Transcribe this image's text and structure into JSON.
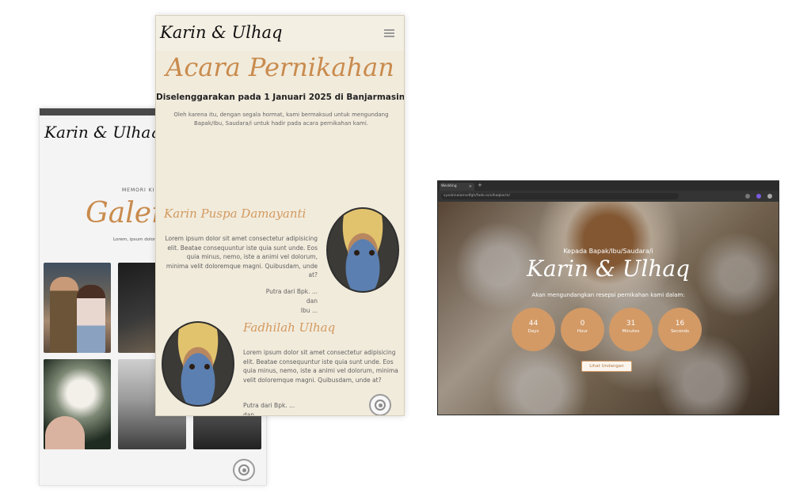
{
  "gallery_screen": {
    "brand": "Karin & Ulhaq",
    "kicker": "MEMORI KI",
    "title": "Galeri",
    "description": "Lorem, ipsum dolor sit amet consec impe"
  },
  "event_screen": {
    "brand": "Karin & Ulhaq",
    "title": "Acara Pernikahan",
    "headline": "Diselenggarakan pada 1 Januari 2025 di Banjarmasin.",
    "intro": "Oleh karena itu, dengan segala hormat, kami bermaksud untuk mengundang Bapak/Ibu, Saudara/i untuk hadir pada acara pernikahan kami.",
    "bride": {
      "name": "Karin Puspa Damayanti",
      "bio": "Lorem ipsum dolor sit amet consectetur adipisicing elit. Beatae consequuntur iste quia sunt unde. Eos quia minus, nemo, iste a animi vel dolorum, minima velit doloremque magni. Quibusdam, unde at?",
      "parents": [
        "Putra dari Bpk. ...",
        "dan",
        "Ibu ..."
      ]
    },
    "groom": {
      "name": "Fadhilah Ulhaq",
      "bio": "Lorem ipsum dolor sit amet consectetur adipisicing elit. Beatae consequuntur iste quia sunt unde. Eos quia minus, nemo, iste a animi vel dolorum, minima velit doloremque magni. Quibusdam, unde at?",
      "parents": [
        "Putra dari Bpk. ...",
        "dan"
      ]
    }
  },
  "browser": {
    "tab_title": "Wedding",
    "url": "syarbinalamsdfgh/fade.io/ulhaqkarin/",
    "hero": {
      "salutation": "Kepada Bapak/Ibu/Saudara/i",
      "couple": "Karin & Ulhaq",
      "invitation": "Akan mengundangkan resepsi pernikahan kami dalam:",
      "countdown": [
        {
          "value": "44",
          "unit": "Days"
        },
        {
          "value": "0",
          "unit": "Hour"
        },
        {
          "value": "31",
          "unit": "Minutes"
        },
        {
          "value": "16",
          "unit": "Seconds"
        }
      ],
      "cta_label": "Lihat Undangan"
    }
  },
  "colors": {
    "accent": "#c98b4d",
    "countdown_bg": "#d39a66",
    "cream": "#f1ebdc"
  }
}
